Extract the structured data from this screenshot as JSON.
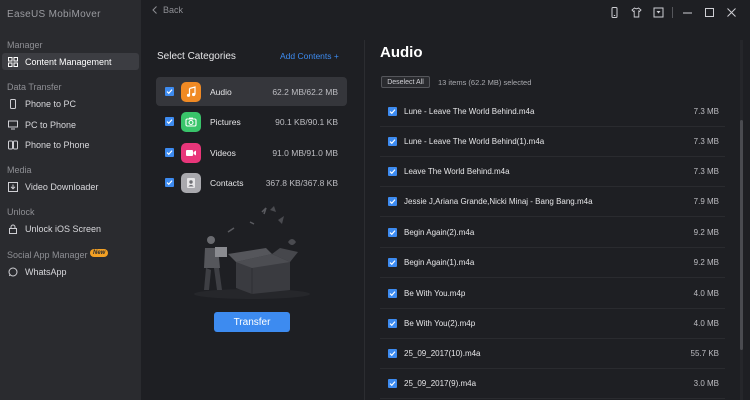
{
  "app": {
    "title": "EaseUS MobiMover"
  },
  "sidebar": {
    "sections": [
      {
        "label": "Manager"
      },
      {
        "label": "Data Transfer"
      },
      {
        "label": "Media"
      },
      {
        "label": "Unlock"
      },
      {
        "label": "Social App Manager",
        "badge": "New"
      }
    ],
    "items": [
      {
        "label": "Content Management",
        "icon": "grid-icon",
        "active": true
      },
      {
        "label": "Phone to PC",
        "icon": "phone-icon"
      },
      {
        "label": "PC to Phone",
        "icon": "monitor-icon"
      },
      {
        "label": "Phone to Phone",
        "icon": "phones-icon"
      },
      {
        "label": "Video Downloader",
        "icon": "download-icon"
      },
      {
        "label": "Unlock iOS Screen",
        "icon": "lock-icon"
      },
      {
        "label": "WhatsApp",
        "icon": "whatsapp-icon"
      }
    ]
  },
  "topbar": {
    "back_label": "Back",
    "icons": [
      "device-icon",
      "tshirt-icon",
      "download-box-icon",
      "minimize-icon",
      "maximize-icon",
      "close-icon"
    ]
  },
  "categories": {
    "title": "Select Categories",
    "add_label": "Add Contents +",
    "items": [
      {
        "name": "Audio",
        "size": "62.2 MB/62.2 MB",
        "color": "#f08a24",
        "icon": "music-icon",
        "selected": true
      },
      {
        "name": "Pictures",
        "size": "90.1 KB/90.1 KB",
        "color": "#39c46a",
        "icon": "camera-icon"
      },
      {
        "name": "Videos",
        "size": "91.0 MB/91.0 MB",
        "color": "#e8367a",
        "icon": "video-icon"
      },
      {
        "name": "Contacts",
        "size": "367.8 KB/367.8 KB",
        "color": "#a9a9ae",
        "icon": "contacts-icon"
      }
    ],
    "transfer_label": "Transfer"
  },
  "content": {
    "title": "Audio",
    "deselect_label": "Deselect All",
    "selection_text": "13 items (62.2 MB) selected",
    "files": [
      {
        "name": "Lune - Leave The World Behind.m4a",
        "size": "7.3 MB"
      },
      {
        "name": "Lune - Leave The World Behind(1).m4a",
        "size": "7.3 MB"
      },
      {
        "name": "Leave The World Behind.m4a",
        "size": "7.3 MB"
      },
      {
        "name": "Jessie J,Ariana Grande,Nicki Minaj - Bang Bang.m4a",
        "size": "7.9 MB"
      },
      {
        "name": "Begin Again(2).m4a",
        "size": "9.2 MB"
      },
      {
        "name": "Begin Again(1).m4a",
        "size": "9.2 MB"
      },
      {
        "name": "Be With You.m4p",
        "size": "4.0 MB"
      },
      {
        "name": "Be With You(2).m4p",
        "size": "4.0 MB"
      },
      {
        "name": "25_09_2017(10).m4a",
        "size": "55.7 KB"
      },
      {
        "name": "25_09_2017(9).m4a",
        "size": "3.0 MB"
      }
    ]
  },
  "colors": {
    "accent": "#3d8bf0",
    "sidebar_bg": "#2a2b2f",
    "main_bg": "#1e1f23",
    "badge": "#f2a024"
  }
}
